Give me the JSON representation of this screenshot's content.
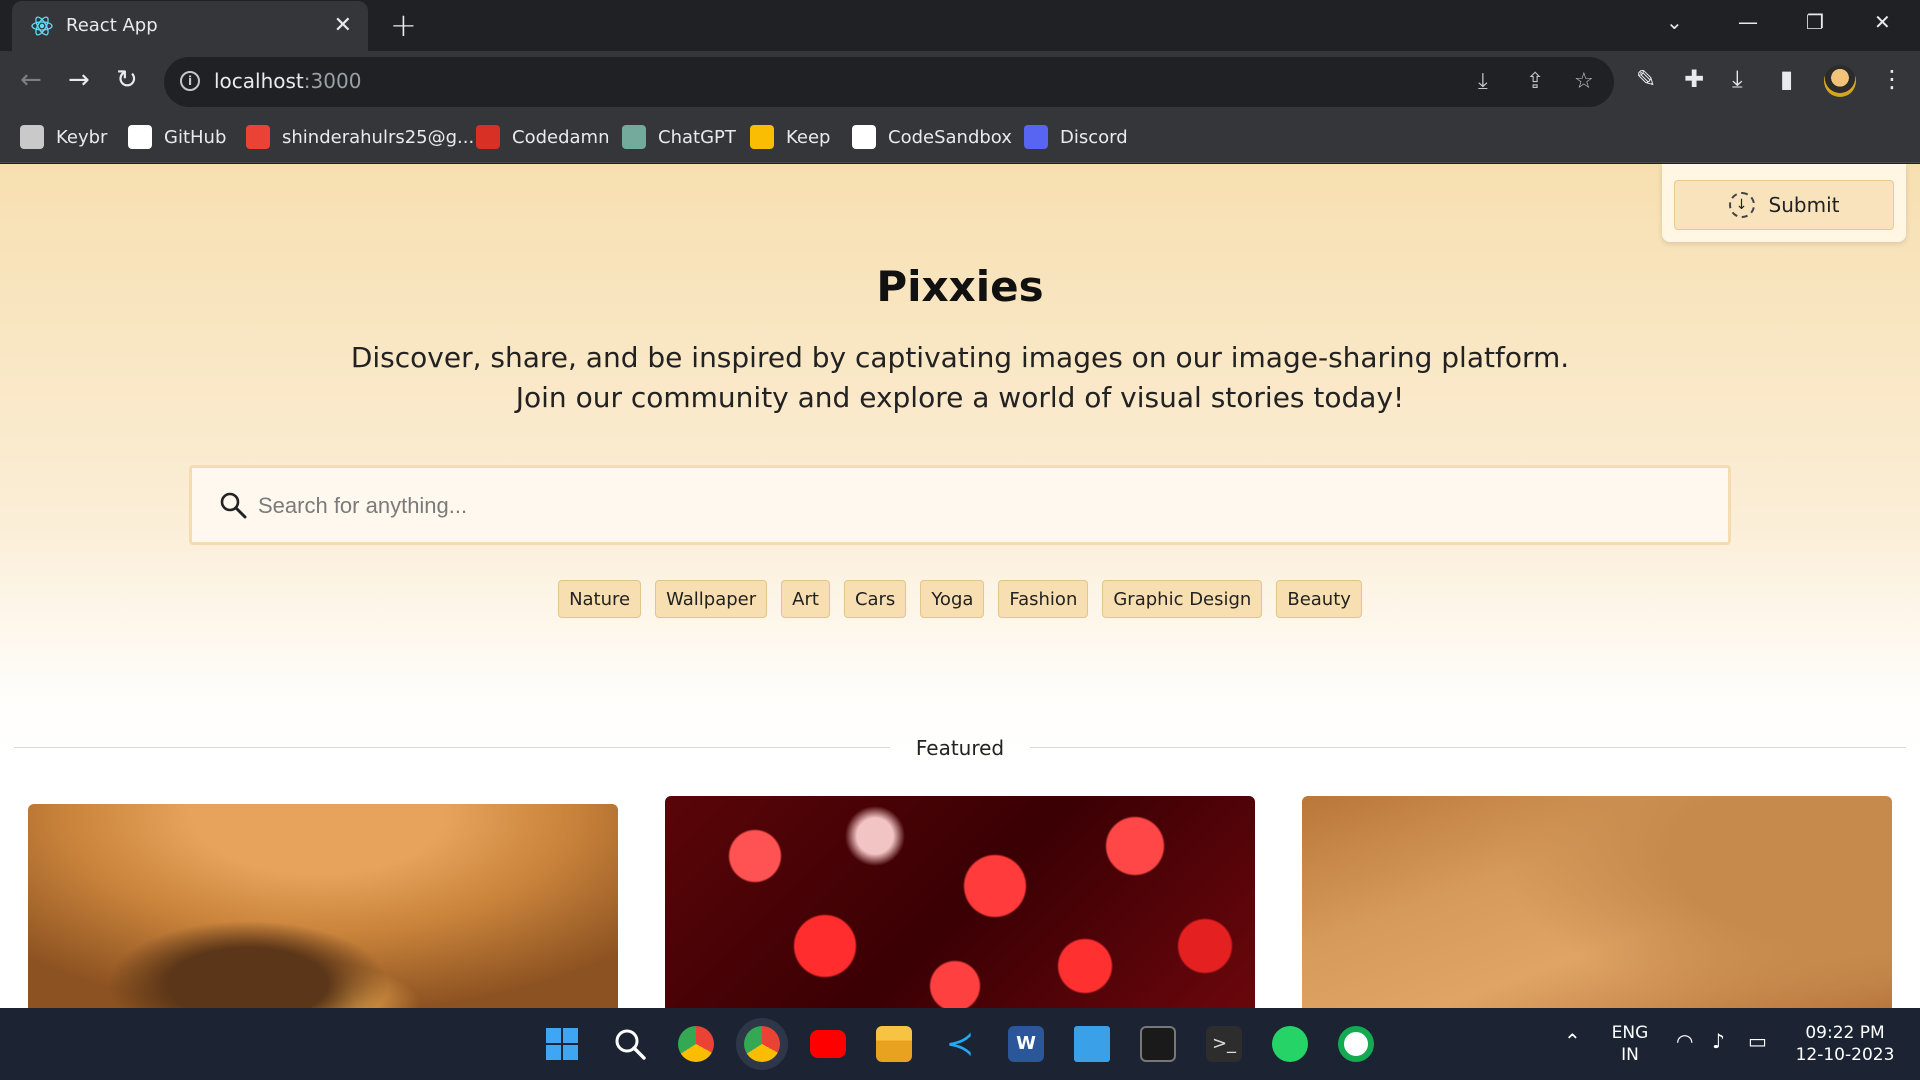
{
  "browser": {
    "tab_title": "React App",
    "url_host": "localhost",
    "url_port": ":3000"
  },
  "bookmarks": [
    {
      "label": "Keybr",
      "icon": "keybr-icon",
      "color": "#c9c9c9"
    },
    {
      "label": "GitHub",
      "icon": "github-icon",
      "color": "#ffffff"
    },
    {
      "label": "shinderahulrs25@g...",
      "icon": "gmail-icon",
      "color": "#ea4335"
    },
    {
      "label": "Codedamn",
      "icon": "codedamn-icon",
      "color": "#d93025"
    },
    {
      "label": "ChatGPT",
      "icon": "chatgpt-icon",
      "color": "#74aa9c"
    },
    {
      "label": "Keep",
      "icon": "keep-icon",
      "color": "#fbbc04"
    },
    {
      "label": "CodeSandbox",
      "icon": "codesandbox-icon",
      "color": "#ffffff"
    },
    {
      "label": "Discord",
      "icon": "discord-icon",
      "color": "#5865f2"
    }
  ],
  "header": {
    "submit_label": "Submit"
  },
  "hero": {
    "title": "Pixxies",
    "subtitle_line1": "Discover, share, and be inspired by captivating images on our image-sharing platform.",
    "subtitle_line2": "Join our community and explore a world of visual stories today!"
  },
  "search": {
    "placeholder": "Search for anything...",
    "value": ""
  },
  "categories": [
    "Nature",
    "Wallpaper",
    "Art",
    "Cars",
    "Yoga",
    "Fashion",
    "Graphic Design",
    "Beauty"
  ],
  "featured": {
    "label": "Featured",
    "images": [
      "desert-rock-image",
      "pomegranate-seeds-image",
      "sand-dunes-image"
    ]
  },
  "taskbar": {
    "lang_line1": "ENG",
    "lang_line2": "IN",
    "time": "09:22 PM",
    "date": "12-10-2023"
  },
  "colors": {
    "accent": "#f7dfb2",
    "chip_border": "#e3c48d",
    "browser_bg": "#202124",
    "taskbar_bg": "#1c2433"
  }
}
